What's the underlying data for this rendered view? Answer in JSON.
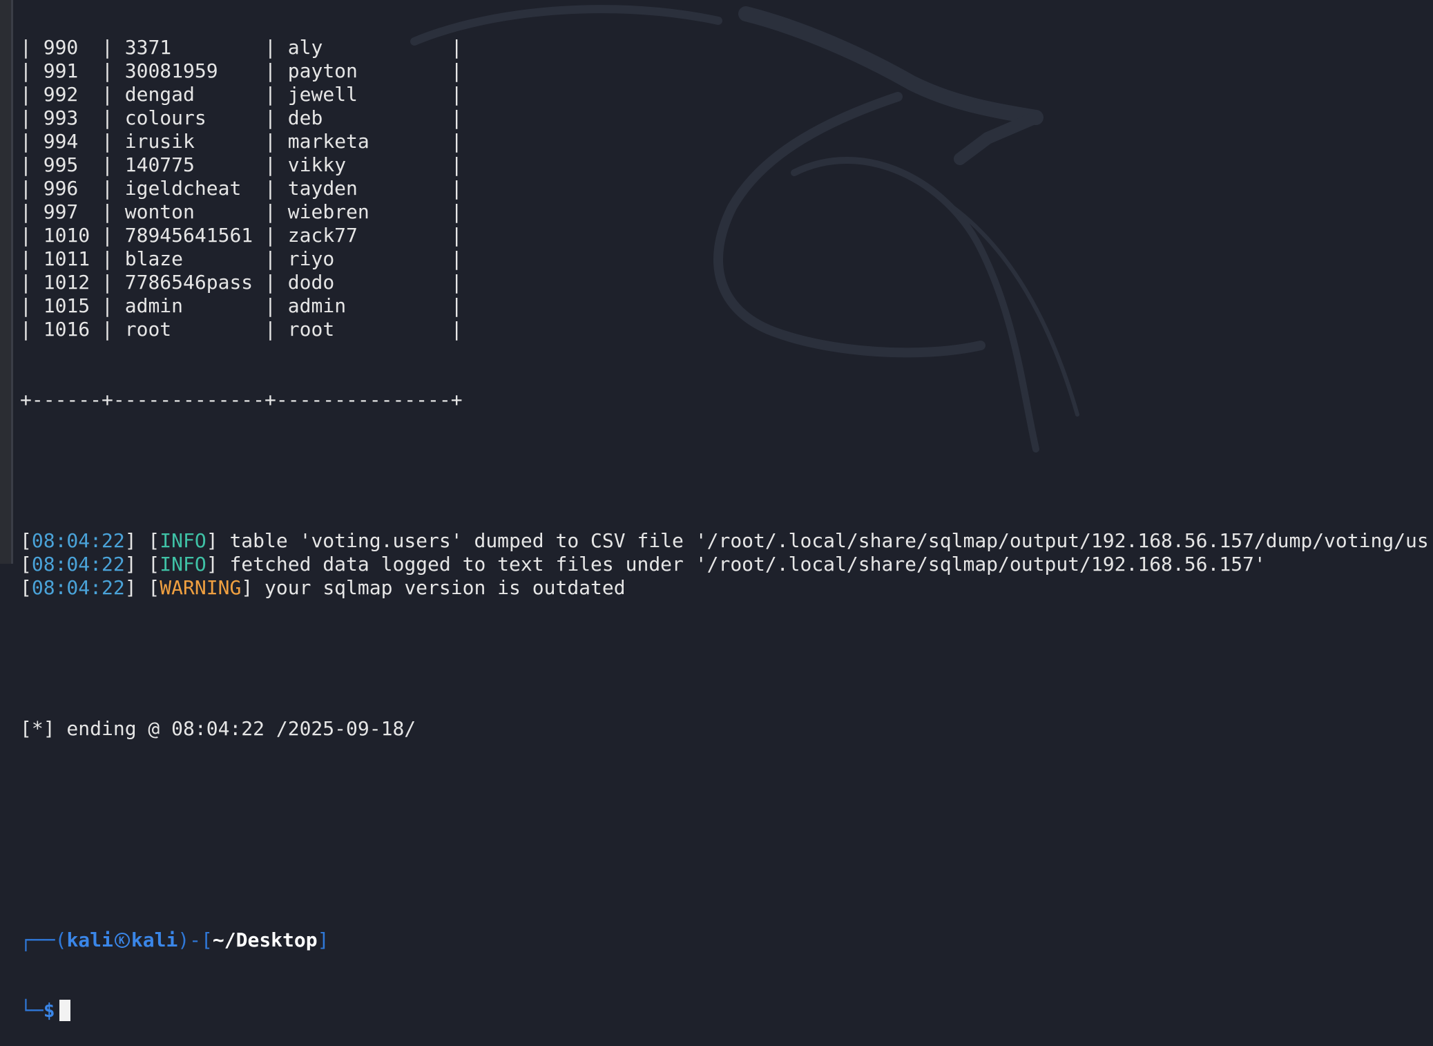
{
  "table": {
    "rows": [
      {
        "id": "990",
        "password": "3371",
        "username": "aly"
      },
      {
        "id": "991",
        "password": "30081959",
        "username": "payton"
      },
      {
        "id": "992",
        "password": "dengad",
        "username": "jewell"
      },
      {
        "id": "993",
        "password": "colours",
        "username": "deb"
      },
      {
        "id": "994",
        "password": "irusik",
        "username": "marketa"
      },
      {
        "id": "995",
        "password": "140775",
        "username": "vikky"
      },
      {
        "id": "996",
        "password": "igeldcheat",
        "username": "tayden"
      },
      {
        "id": "997",
        "password": "wonton",
        "username": "wiebren"
      },
      {
        "id": "1010",
        "password": "78945641561",
        "username": "zack77"
      },
      {
        "id": "1011",
        "password": "blaze",
        "username": "riyo"
      },
      {
        "id": "1012",
        "password": "7786546pass",
        "username": "dodo"
      },
      {
        "id": "1015",
        "password": "admin",
        "username": "admin"
      },
      {
        "id": "1016",
        "password": "root",
        "username": "root"
      }
    ],
    "border_line": "+------+-------------+---------------+"
  },
  "log": [
    {
      "time": "08:04:22",
      "level": "INFO",
      "level_color": "#3fc2a6",
      "message": " table 'voting.users' dumped to CSV file '/root/.local/share/sqlmap/output/192.168.56.157/dump/voting/us"
    },
    {
      "time": "08:04:22",
      "level": "INFO",
      "level_color": "#3fc2a6",
      "message": " fetched data logged to text files under '/root/.local/share/sqlmap/output/192.168.56.157'"
    },
    {
      "time": "08:04:22",
      "level": "WARNING",
      "level_color": "#f0a040",
      "message": " your sqlmap version is outdated"
    }
  ],
  "ending": "[*] ending @ 08:04:22 /2025-09-18/",
  "prompt": {
    "corner_top": "┌──(",
    "user": "kali",
    "host": "kali",
    "sep": ")-[",
    "path": "~/Desktop",
    "close": "]",
    "corner_bottom": "└─",
    "symbol": "$"
  },
  "colors": {
    "background": "#1e212b",
    "timestamp": "#4aa3d9",
    "info": "#3fc2a6",
    "warning": "#f0a040",
    "prompt": "#3a86e8"
  },
  "icons": [
    "kali-dragon-icon",
    "kali-skull-icon"
  ]
}
